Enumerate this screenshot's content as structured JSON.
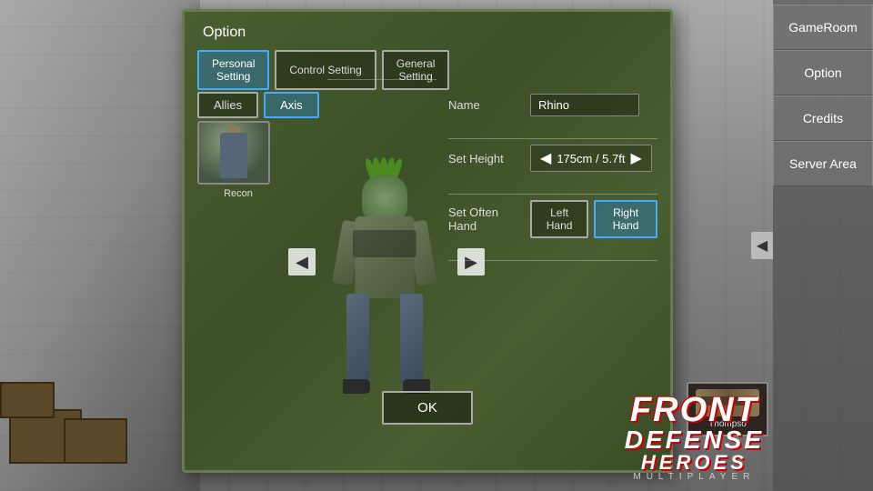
{
  "background": {
    "color": "#4a4a4a"
  },
  "panel": {
    "title": "Option"
  },
  "tabs": {
    "personal": {
      "label": "Personal\nSetting",
      "active": true
    },
    "control": {
      "label": "Control Setting",
      "active": false
    },
    "general": {
      "label": "General\nSetting",
      "active": false
    }
  },
  "factions": {
    "allies": {
      "label": "Allies",
      "active": false
    },
    "axis": {
      "label": "Axis",
      "active": true
    }
  },
  "character": {
    "thumbnail_label": "Recon"
  },
  "settings": {
    "name_label": "Name",
    "name_value": "Rhino",
    "height_label": "Set Height",
    "height_value": "175cm / 5.7ft",
    "hand_label": "Set Often Hand",
    "left_hand": "Left Hand",
    "right_hand": "Right Hand",
    "right_hand_active": true
  },
  "ok_button": "OK",
  "sidebar": {
    "gameroom": "GameRoom",
    "option": "Option",
    "credits": "Credits",
    "server_area": "Server Area"
  },
  "weapon": {
    "name": "Thompso"
  },
  "logo": {
    "line1": "FRONT",
    "line2": "DEFENSE",
    "line3": "HEROES",
    "line4": "MULTIPLAYER"
  },
  "arrows": {
    "left": "◄",
    "right": "►"
  }
}
